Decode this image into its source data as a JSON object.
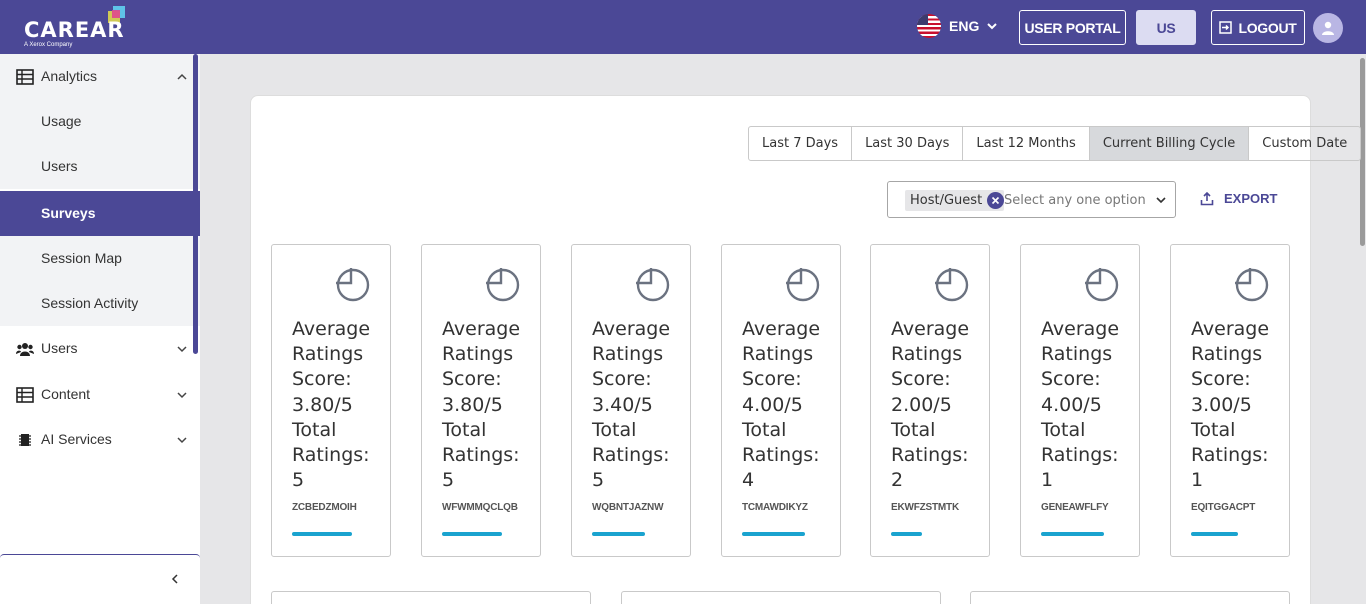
{
  "header": {
    "brand": "CAREAR",
    "brand_sub": "A Xerox Company",
    "language": "ENG",
    "user_portal_label": "USER PORTAL",
    "region_label": "US",
    "logout_label": "LOGOUT"
  },
  "sidebar": {
    "analytics": "Analytics",
    "analytics_items": [
      "Usage",
      "Users",
      "Surveys",
      "Session Map",
      "Session Activity"
    ],
    "users": "Users",
    "content": "Content",
    "ai_services": "AI Services"
  },
  "filters": {
    "ranges": [
      "Last 7 Days",
      "Last 30 Days",
      "Last 12 Months",
      "Current Billing Cycle",
      "Custom Date"
    ],
    "active_range": "Current Billing Cycle",
    "chip": "Host/Guest",
    "placeholder": "Select any one option",
    "export_label": "EXPORT"
  },
  "cards": [
    {
      "lines": [
        "Average",
        "Ratings",
        "Score:",
        "3.80/5",
        "Total",
        "Ratings:",
        "5"
      ],
      "code": "ZCBEDZMOIH",
      "bar": 0.65
    },
    {
      "lines": [
        "Average",
        "Ratings",
        "Score:",
        "3.80/5",
        "Total",
        "Ratings:",
        "5"
      ],
      "code": "WFWMMQCLQB",
      "bar": 0.65
    },
    {
      "lines": [
        "Average",
        "Ratings",
        "Score:",
        "3.40/5",
        "Total",
        "Ratings:",
        "5"
      ],
      "code": "WQBNTJAZNW",
      "bar": 0.58
    },
    {
      "lines": [
        "Average",
        "Ratings",
        "Score:",
        "4.00/5",
        "Total",
        "Ratings:",
        "4"
      ],
      "code": "TCMAWDIKYZ",
      "bar": 0.68
    },
    {
      "lines": [
        "Average",
        "Ratings",
        "Score:",
        "2.00/5",
        "Total",
        "Ratings:",
        "2"
      ],
      "code": "EKWFZSTMTK",
      "bar": 0.34
    },
    {
      "lines": [
        "Average",
        "Ratings",
        "Score:",
        "4.00/5",
        "Total",
        "Ratings:",
        "1"
      ],
      "code": "GENEAWFLFY",
      "bar": 0.68
    },
    {
      "lines": [
        "Average",
        "Ratings",
        "Score:",
        "3.00/5",
        "Total",
        "Ratings:",
        "1"
      ],
      "code": "EQITGGACPT",
      "bar": 0.51
    }
  ],
  "colors": {
    "brand": "#4b4896",
    "bar": "#1aa3cf"
  }
}
